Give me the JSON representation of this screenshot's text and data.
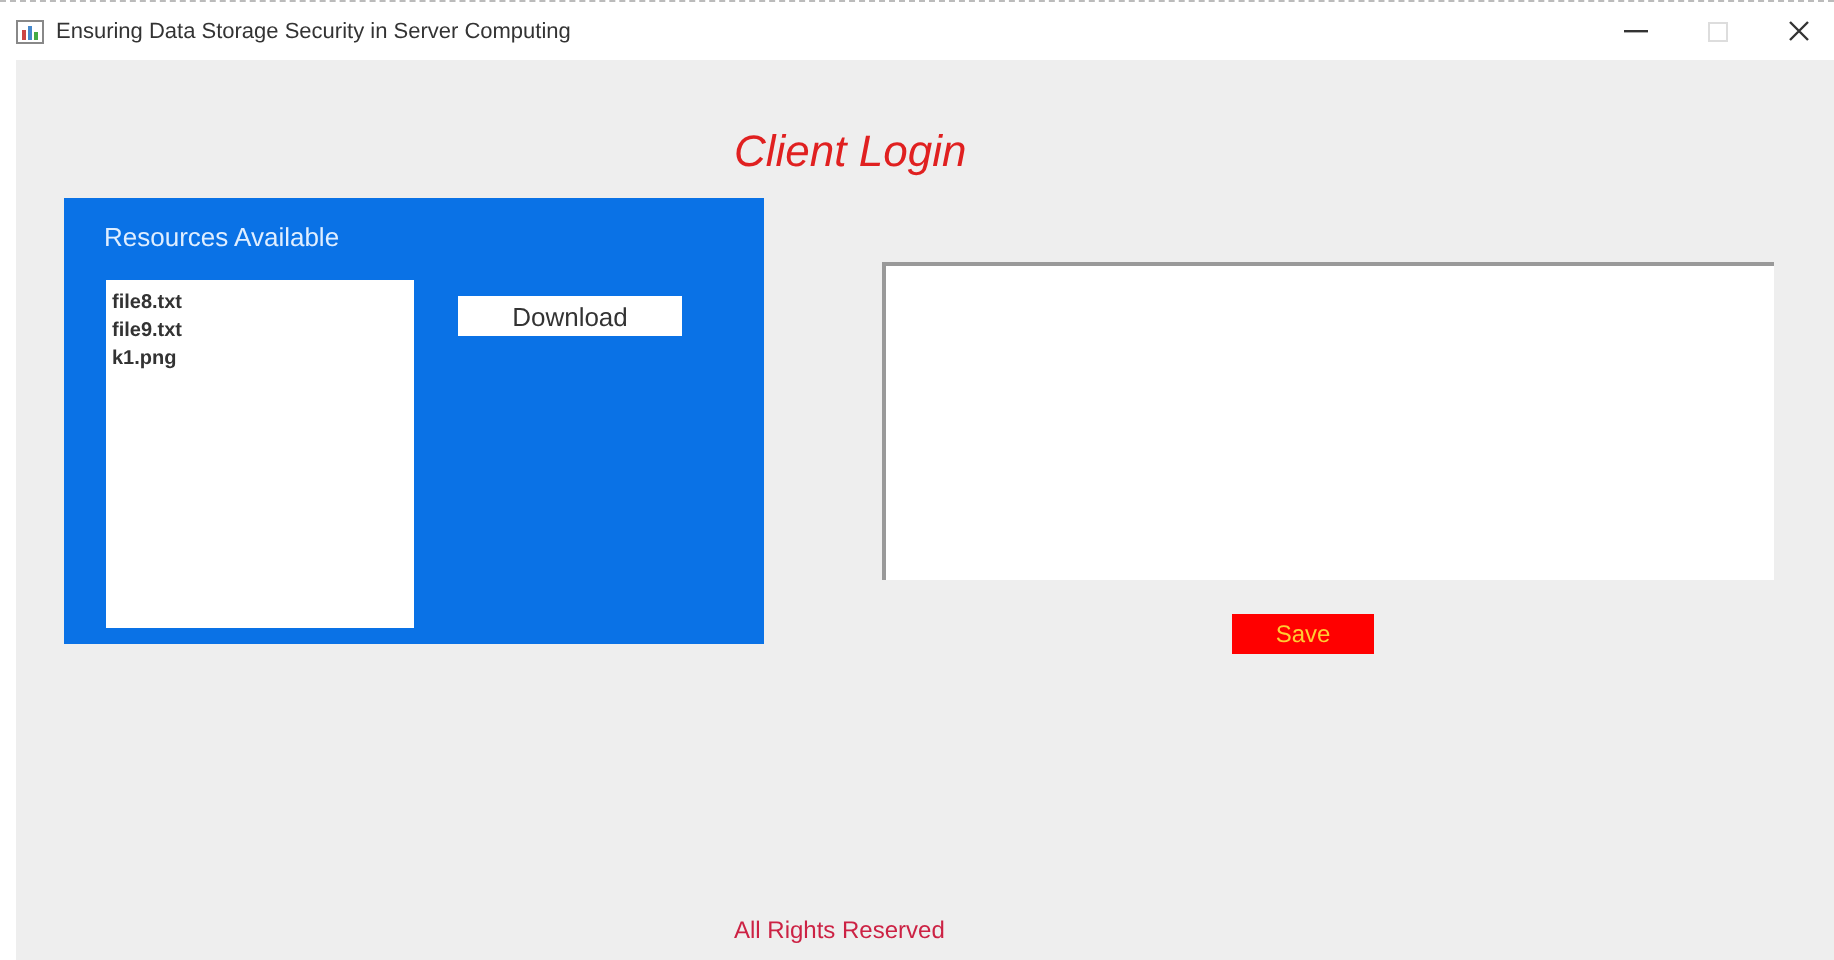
{
  "window": {
    "title": "Ensuring Data Storage Security in Server Computing"
  },
  "heading": "Client Login",
  "resources": {
    "title": "Resources Available",
    "files": [
      "file8.txt",
      "file9.txt",
      "k1.png"
    ],
    "button": "Download"
  },
  "save_button": "Save",
  "footer": "All Rights Reserved"
}
